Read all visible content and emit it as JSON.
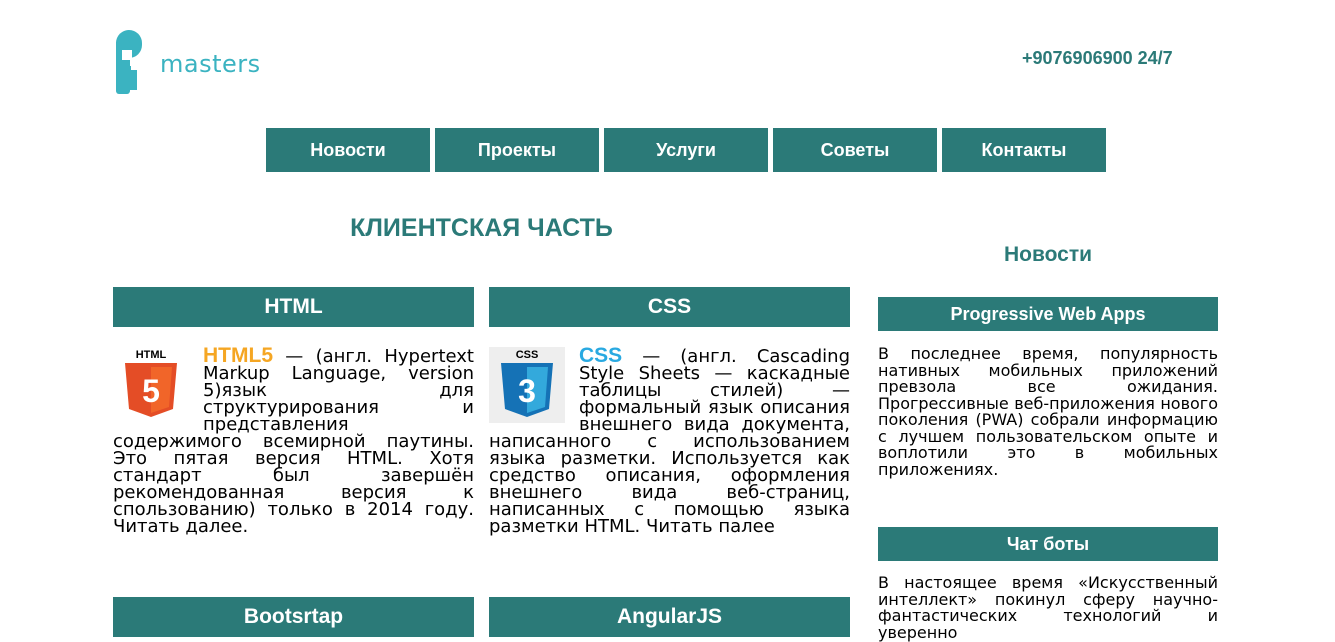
{
  "header": {
    "logo_text": "masters",
    "phone": "+9076906900 24/7"
  },
  "nav": {
    "items": [
      "Новости",
      "Проекты",
      "Услуги",
      "Советы",
      "Контакты"
    ]
  },
  "main": {
    "section_title": "КЛИЕНТСКАЯ ЧАСТЬ",
    "cards": [
      {
        "title": "HTML",
        "highlight": "HTML5",
        "text": " — (англ. Hypertext Markup Language, version 5)язык для структурирования и представления содержимого всемирной паутины. Это пятая версия HTML. Хотя стандарт был завершён рекомендованная версия к спользованию) только в 2014 году. Читать далее."
      },
      {
        "title": "CSS",
        "highlight": "CSS",
        "text": " — (англ. Cascading Style Sheets — каскадные таблицы стилей) — формальный язык описания внешнего вида документа, написанного с использованием языка разметки. Используется как средство описания, оформления внешнего вида веб-страниц, написанных с помощью языка разметки HTML. Читать палее"
      },
      {
        "title": "Bootsrtap"
      },
      {
        "title": "AngularJS"
      }
    ],
    "icons": {
      "html5": {
        "label": "HTML",
        "color": "#e44d26"
      },
      "css3": {
        "label": "CSS",
        "color": "#1572b6"
      }
    }
  },
  "news": {
    "title": "Новости",
    "items": [
      {
        "title": "Progressive Web Apps",
        "text": "В последнее время, популярность нативных мобильных приложений превзола все ожидания. Прогрессивные веб-приложения нового поколения (PWA) собрали информацию с лучшем пользовательском опыте и воплотили это в мобильных приложениях."
      },
      {
        "title": "Чат боты",
        "text": "В настоящее время «Искусственный интеллект» покинул сферу научно-фантастических технологий и уверенно"
      }
    ]
  },
  "colors": {
    "accent": "#2b7a78",
    "logo": "#3bb3c1",
    "html_highlight": "#f5a623",
    "css_highlight": "#29a9e1"
  }
}
